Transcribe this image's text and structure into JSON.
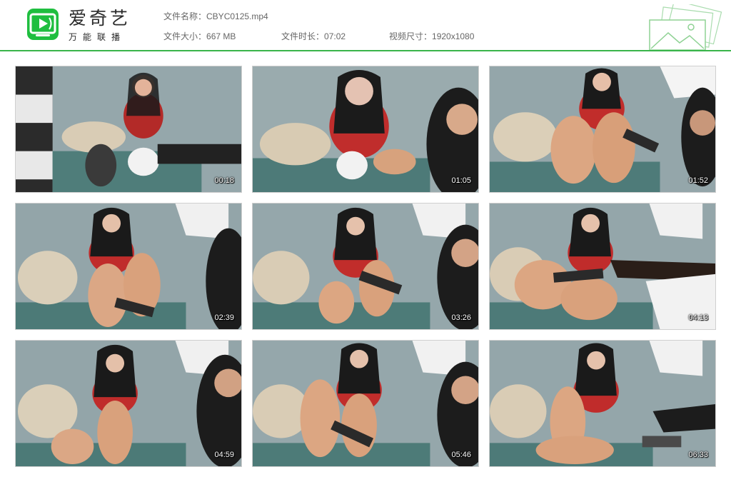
{
  "brand": {
    "title": "爱奇艺",
    "subtitle": "万能联播"
  },
  "file": {
    "name_label": "文件名称：",
    "name": "CBYC0125.mp4",
    "size_label": "文件大小：",
    "size": "667 MB",
    "duration_label": "文件时长：",
    "duration": "07:02",
    "resolution_label": "视频尺寸：",
    "resolution": "1920x1080"
  },
  "colors": {
    "accent": "#39b54a",
    "logo_bg": "#1fbe3f"
  },
  "thumbnails": [
    {
      "timestamp": "00:18"
    },
    {
      "timestamp": "01:05"
    },
    {
      "timestamp": "01:52"
    },
    {
      "timestamp": "02:39"
    },
    {
      "timestamp": "03:26"
    },
    {
      "timestamp": "04:13"
    },
    {
      "timestamp": "04:59"
    },
    {
      "timestamp": "05:46"
    },
    {
      "timestamp": "06:33"
    }
  ]
}
